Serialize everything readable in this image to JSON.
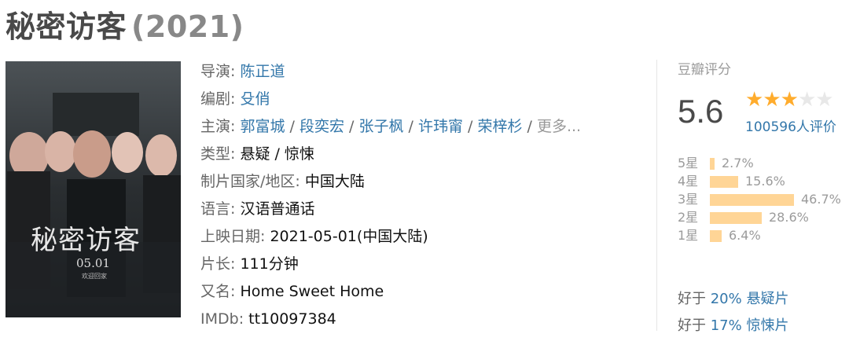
{
  "movie": {
    "title": "秘密访客",
    "year": "(2021)"
  },
  "poster": {
    "title_text": "秘密访客",
    "date_text": "05.01",
    "sub_text": "欢迎回家"
  },
  "info": {
    "director": {
      "label": "导演: ",
      "values": [
        "陈正道"
      ]
    },
    "writer": {
      "label": "编剧: ",
      "values": [
        "殳俏"
      ]
    },
    "cast": {
      "label": "主演: ",
      "values": [
        "郭富城",
        "段奕宏",
        "张子枫",
        "许玮甯",
        "荣梓杉"
      ],
      "more": "更多..."
    },
    "genre": {
      "label": "类型: ",
      "value": "悬疑 / 惊悚"
    },
    "country": {
      "label": "制片国家/地区: ",
      "value": "中国大陆"
    },
    "language": {
      "label": "语言: ",
      "value": "汉语普通话"
    },
    "release": {
      "label": "上映日期: ",
      "value": "2021-05-01(中国大陆)"
    },
    "runtime": {
      "label": "片长: ",
      "value": "111分钟"
    },
    "aka": {
      "label": "又名: ",
      "value": "Home Sweet Home"
    },
    "imdb": {
      "label": "IMDb: ",
      "value": "tt10097384"
    }
  },
  "rating": {
    "label": "豆瓣评分",
    "score": "5.6",
    "stars_filled": 3,
    "stars_total": 5,
    "votes": "100596人评价",
    "distribution": [
      {
        "label": "5星",
        "percent": "2.7%",
        "value": 2.7
      },
      {
        "label": "4星",
        "percent": "15.6%",
        "value": 15.6
      },
      {
        "label": "3星",
        "percent": "46.7%",
        "value": 46.7
      },
      {
        "label": "2星",
        "percent": "28.6%",
        "value": 28.6
      },
      {
        "label": "1星",
        "percent": "6.4%",
        "value": 6.4
      }
    ]
  },
  "better_than": [
    {
      "prefix": "好于 ",
      "value": "20% 悬疑片"
    },
    {
      "prefix": "好于 ",
      "value": "17% 惊悚片"
    }
  ],
  "colors": {
    "link": "#3377aa",
    "star": "#ffac2d",
    "bar": "#ffd596"
  }
}
